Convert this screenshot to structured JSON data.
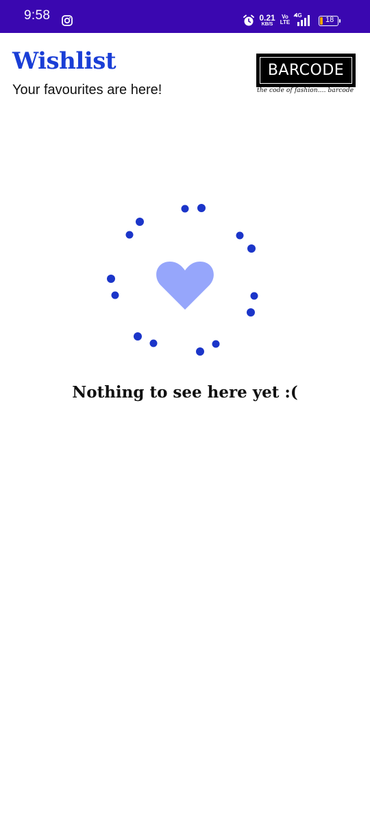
{
  "status_bar": {
    "time": "9:58",
    "notification_icon": "instagram-icon",
    "alarm_icon": "alarm-clock-icon",
    "network_speed_value": "0.21",
    "network_speed_unit": "KB/S",
    "volte_top": "Vo",
    "volte_bottom": "LTE",
    "network_type": "4G",
    "signal_icon": "signal-bars-icon",
    "battery_level": "18",
    "battery_fraction": 0.18,
    "background_color": "#3a07b0"
  },
  "header": {
    "title": "Wishlist",
    "subtitle": "Your favourites are here!",
    "title_color": "#1a3ed6"
  },
  "brand": {
    "logo_text": "BARCODE",
    "tagline": "the code of fashion.... barcode"
  },
  "empty_state": {
    "icon": "heart-icon",
    "heart_color": "#96a6fb",
    "dot_color": "#1b35c9",
    "message": "Nothing to see here yet :("
  }
}
